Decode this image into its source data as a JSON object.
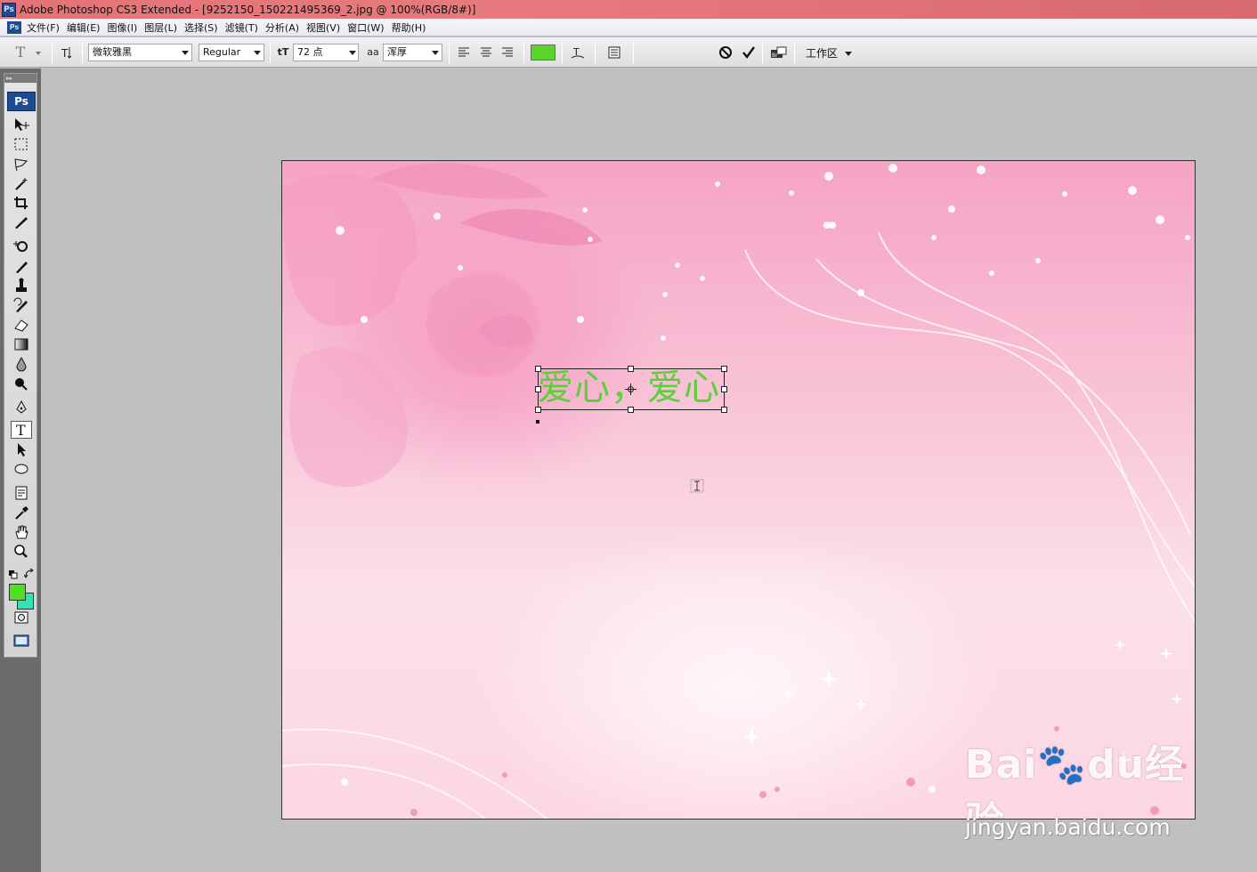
{
  "window": {
    "title": "Adobe Photoshop CS3 Extended - [9252150_150221495369_2.jpg @ 100%(RGB/8#)]",
    "app_badge": "Ps"
  },
  "menu": {
    "items": [
      "文件(F)",
      "编辑(E)",
      "图像(I)",
      "图层(L)",
      "选择(S)",
      "滤镜(T)",
      "分析(A)",
      "视图(V)",
      "窗口(W)",
      "帮助(H)"
    ]
  },
  "options_bar": {
    "tool_icon": "T",
    "orientation_icon": "text-orientation-icon",
    "font_family": "微软雅黑",
    "font_style": "Regular",
    "font_size": "72 点",
    "size_icon": "tT",
    "antialias_icon": "aa",
    "antialias": "浑厚",
    "text_color": "#5ad32a",
    "workspace": "工作区"
  },
  "toolbox": {
    "badge": "Ps",
    "foreground_color": "#4ce21f",
    "background_color": "#31e4b5"
  },
  "document": {
    "text_content": "爱心，爱心",
    "text_color": "#5ccf3a"
  },
  "watermark": {
    "brand": "Bai🐾du经验",
    "url": "jingyan.baidu.com"
  }
}
